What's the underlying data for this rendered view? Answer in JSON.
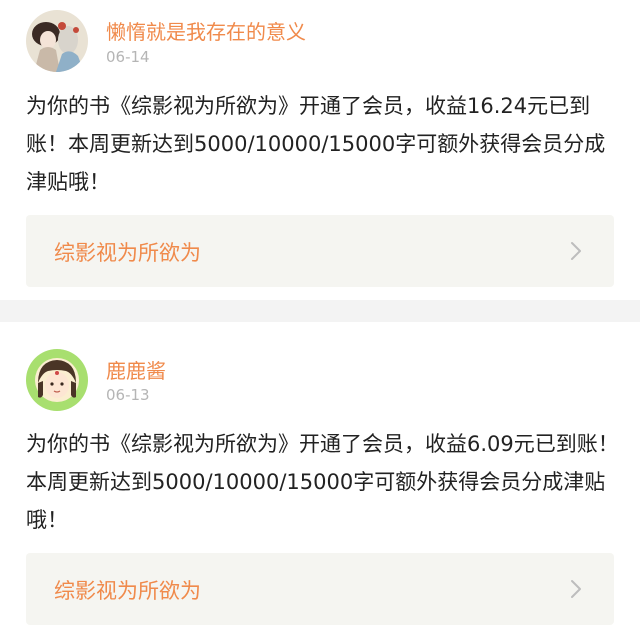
{
  "notifications": [
    {
      "username": "懒惰就是我存在的意义",
      "date": "06-14",
      "avatar_icon": "anime-character-avatar-icon",
      "message": "为你的书《综影视为所欲为》开通了会员，收益16.24元已到账！本周更新达到5000/10000/15000字可额外获得会员分成津贴哦！",
      "book_title": "综影视为所欲为"
    },
    {
      "username": "鹿鹿酱",
      "date": "06-13",
      "avatar_icon": "cartoon-girl-avatar-icon",
      "message": "为你的书《综影视为所欲为》开通了会员，收益6.09元已到账！本周更新达到5000/10000/15000字可额外获得会员分成津贴哦！",
      "book_title": "综影视为所欲为"
    }
  ],
  "colors": {
    "accent": "#f08a4b",
    "date_gray": "#b5b5b5",
    "text": "#222222",
    "link_bg": "#f5f5f1",
    "separator": "#f3f3f3"
  }
}
